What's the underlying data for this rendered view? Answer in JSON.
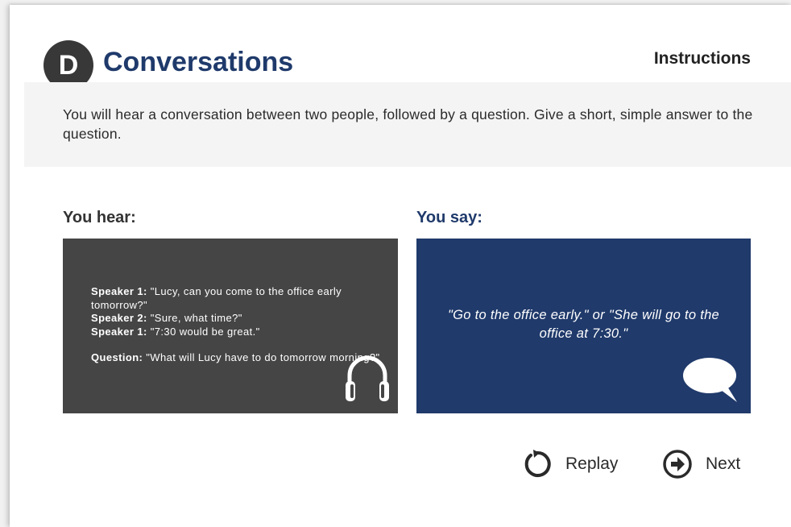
{
  "header": {
    "badge": "D",
    "title": "Conversations",
    "instructions_label": "Instructions"
  },
  "instructions": {
    "text": "You will hear a conversation between two people, followed by a question. Give a short, simple answer to the question."
  },
  "hear": {
    "label": "You hear:",
    "lines": [
      {
        "speaker": "Speaker 1:",
        "text": " \"Lucy, can you come to the office early tomorrow?\""
      },
      {
        "speaker": "Speaker 2:",
        "text": " \"Sure, what time?\""
      },
      {
        "speaker": "Speaker 1:",
        "text": " \"7:30 would be great.\""
      }
    ],
    "question_label": "Question:",
    "question_text": " \"What will Lucy have to do tomorrow morning?\"",
    "icon": "headphones-icon"
  },
  "say": {
    "label": "You say:",
    "answer": "\"Go to the office early.\" or \"She will go to the office at 7:30.\"",
    "icon": "speech-bubble-icon"
  },
  "controls": {
    "replay_label": "Replay",
    "next_label": "Next",
    "replay_icon": "replay-icon",
    "next_icon": "next-arrow-icon"
  },
  "colors": {
    "accent": "#1f3a6b",
    "hear_panel": "#454545",
    "say_panel": "#203a6b",
    "badge": "#383838"
  }
}
